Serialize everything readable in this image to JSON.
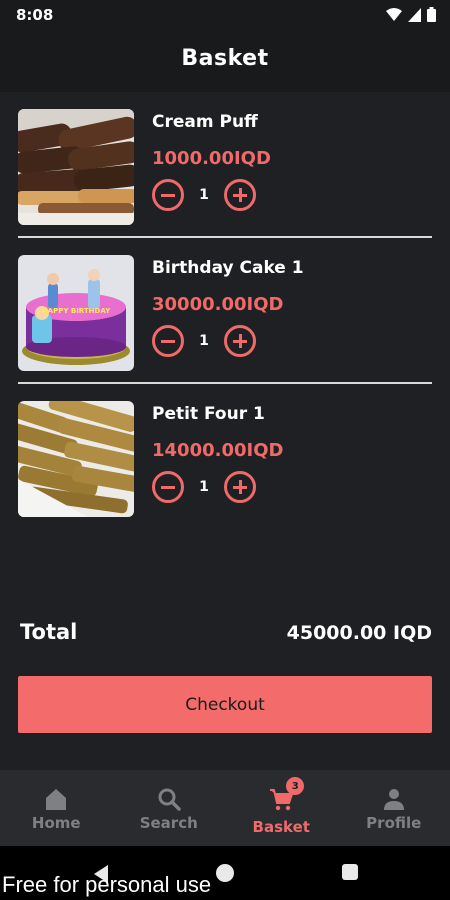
{
  "status_bar": {
    "time": "8:08"
  },
  "app_bar": {
    "title": "Basket"
  },
  "items": [
    {
      "name": "Cream Puff",
      "price": "1000.00IQD",
      "quantity": "1",
      "thumb_icon": "cream-puff-image"
    },
    {
      "name": "Birthday Cake 1",
      "price": "30000.00IQD",
      "quantity": "1",
      "thumb_icon": "birthday-cake-image",
      "cake_text": "HAPPY BIRTHDAY"
    },
    {
      "name": "Petit Four 1",
      "price": "14000.00IQD",
      "quantity": "1",
      "thumb_icon": "petit-four-image"
    }
  ],
  "summary": {
    "total_label": "Total",
    "total_value": "45000.00 IQD"
  },
  "checkout": {
    "label": "Checkout"
  },
  "bottom_nav": {
    "items": [
      {
        "label": "Home",
        "icon": "home-icon"
      },
      {
        "label": "Search",
        "icon": "search-icon"
      },
      {
        "label": "Basket",
        "icon": "cart-icon",
        "badge": "3",
        "active": true
      },
      {
        "label": "Profile",
        "icon": "person-icon"
      }
    ]
  },
  "watermark": "Free for personal use",
  "colors": {
    "accent": "#f06a6a",
    "background": "#1f2023",
    "bar": "#181a1c",
    "nav": "#2a2b2f"
  }
}
